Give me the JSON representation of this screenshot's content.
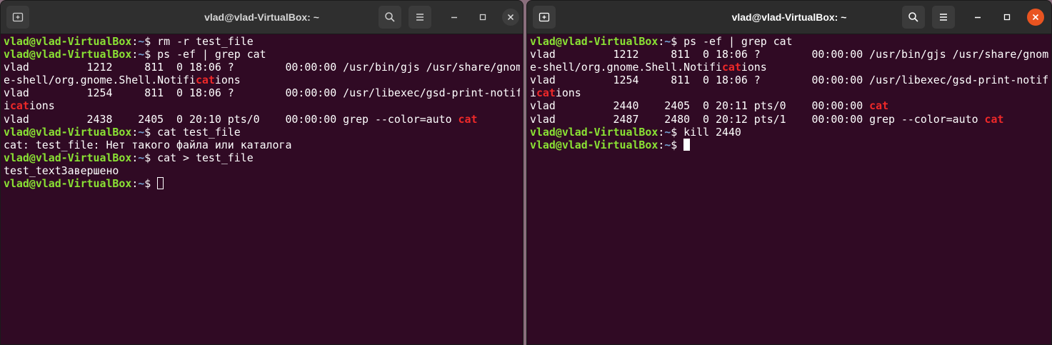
{
  "left_window": {
    "title": "vlad@vlad-VirtualBox: ~",
    "lines": [
      {
        "type": "prompt",
        "user": "vlad@vlad-VirtualBox",
        "sep": ":",
        "path": "~",
        "sym": "$",
        "cmd": " rm -r test_file"
      },
      {
        "type": "prompt",
        "user": "vlad@vlad-VirtualBox",
        "sep": ":",
        "path": "~",
        "sym": "$",
        "cmd": " ps -ef | grep cat"
      },
      {
        "type": "text",
        "segments": [
          {
            "t": "vlad         1212     811  0 18:06 ?        00:00:00 /usr/bin/gjs /usr/share/gnom"
          }
        ]
      },
      {
        "type": "text",
        "segments": [
          {
            "t": "e-shell/org.gnome.Shell.Notifi"
          },
          {
            "t": "cat",
            "hl": true
          },
          {
            "t": "ions"
          }
        ]
      },
      {
        "type": "text",
        "segments": [
          {
            "t": "vlad         1254     811  0 18:06 ?        00:00:00 /usr/libexec/gsd-print-notif"
          }
        ]
      },
      {
        "type": "text",
        "segments": [
          {
            "t": "i"
          },
          {
            "t": "cat",
            "hl": true
          },
          {
            "t": "ions"
          }
        ]
      },
      {
        "type": "text",
        "segments": [
          {
            "t": "vlad         2438    2405  0 20:10 pts/0    00:00:00 grep --color=auto "
          },
          {
            "t": "cat",
            "hl": true
          }
        ]
      },
      {
        "type": "prompt",
        "user": "vlad@vlad-VirtualBox",
        "sep": ":",
        "path": "~",
        "sym": "$",
        "cmd": " cat test_file"
      },
      {
        "type": "text",
        "segments": [
          {
            "t": "cat: test_file: Нет такого файла или каталога"
          }
        ]
      },
      {
        "type": "prompt",
        "user": "vlad@vlad-VirtualBox",
        "sep": ":",
        "path": "~",
        "sym": "$",
        "cmd": " cat > test_file"
      },
      {
        "type": "text",
        "segments": [
          {
            "t": "test_textЗавершено"
          }
        ]
      },
      {
        "type": "prompt",
        "user": "vlad@vlad-VirtualBox",
        "sep": ":",
        "path": "~",
        "sym": "$",
        "cmd": " ",
        "cursor": "hollow"
      }
    ]
  },
  "right_window": {
    "title": "vlad@vlad-VirtualBox: ~",
    "lines": [
      {
        "type": "prompt",
        "user": "vlad@vlad-VirtualBox",
        "sep": ":",
        "path": "~",
        "sym": "$",
        "cmd": " ps -ef | grep cat"
      },
      {
        "type": "text",
        "segments": [
          {
            "t": "vlad         1212     811  0 18:06 ?        00:00:00 /usr/bin/gjs /usr/share/gnom"
          }
        ]
      },
      {
        "type": "text",
        "segments": [
          {
            "t": "e-shell/org.gnome.Shell.Notifi"
          },
          {
            "t": "cat",
            "hl": true
          },
          {
            "t": "ions"
          }
        ]
      },
      {
        "type": "text",
        "segments": [
          {
            "t": "vlad         1254     811  0 18:06 ?        00:00:00 /usr/libexec/gsd-print-notif"
          }
        ]
      },
      {
        "type": "text",
        "segments": [
          {
            "t": "i"
          },
          {
            "t": "cat",
            "hl": true
          },
          {
            "t": "ions"
          }
        ]
      },
      {
        "type": "text",
        "segments": [
          {
            "t": "vlad         2440    2405  0 20:11 pts/0    00:00:00 "
          },
          {
            "t": "cat",
            "hl": true
          }
        ]
      },
      {
        "type": "text",
        "segments": [
          {
            "t": "vlad         2487    2480  0 20:12 pts/1    00:00:00 grep --color=auto "
          },
          {
            "t": "cat",
            "hl": true
          }
        ]
      },
      {
        "type": "prompt",
        "user": "vlad@vlad-VirtualBox",
        "sep": ":",
        "path": "~",
        "sym": "$",
        "cmd": " kill 2440"
      },
      {
        "type": "prompt",
        "user": "vlad@vlad-VirtualBox",
        "sep": ":",
        "path": "~",
        "sym": "$",
        "cmd": " ",
        "cursor": "solid"
      }
    ]
  },
  "icons": {
    "new_tab": "new-tab-icon",
    "search": "search-icon",
    "menu": "hamburger-menu-icon",
    "minimize": "minimize-icon",
    "maximize": "maximize-icon",
    "close": "close-icon"
  },
  "colors": {
    "terminal_bg": "#300a24",
    "prompt_user": "#8ae234",
    "prompt_path": "#729fcf",
    "grep_highlight": "#ef2929",
    "close_active": "#e95420"
  }
}
